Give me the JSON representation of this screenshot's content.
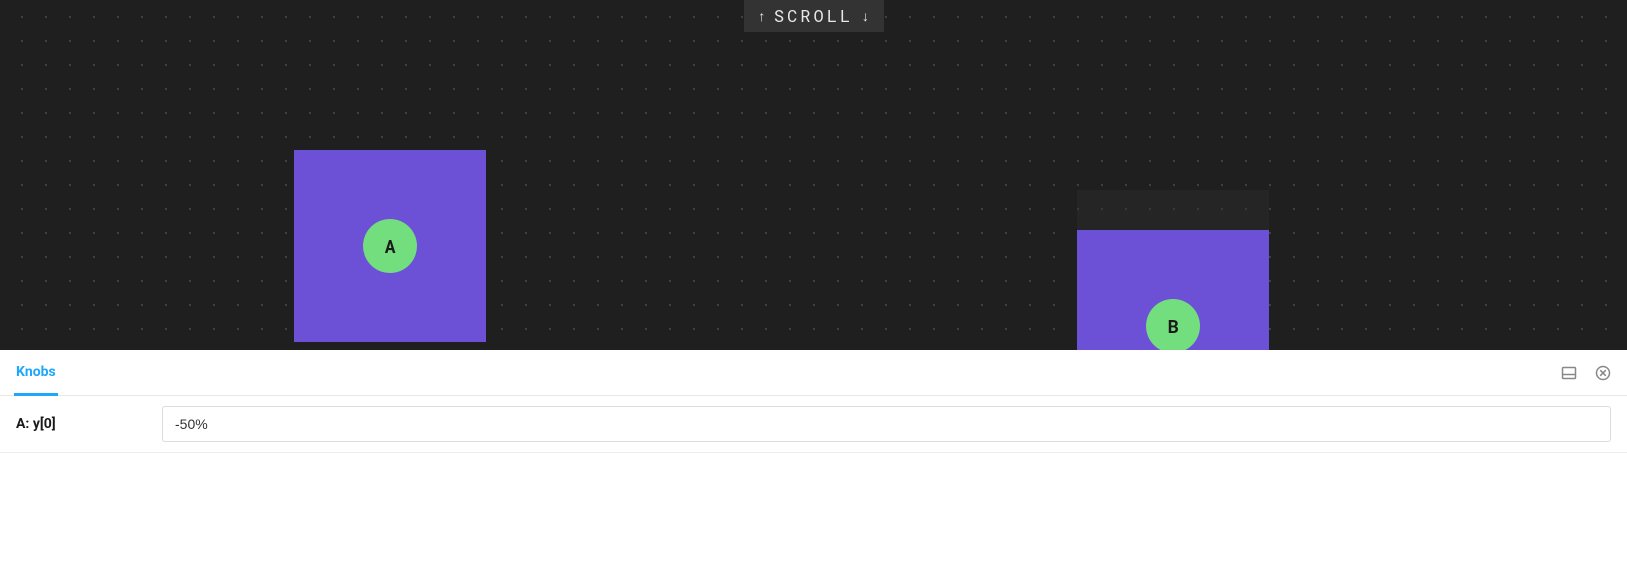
{
  "hint": {
    "text": "SCROLL"
  },
  "blocks": {
    "a": {
      "label": "A"
    },
    "b": {
      "label": "B"
    }
  },
  "panel": {
    "tab_label": "Knobs",
    "knob": {
      "label": "A: y[0]",
      "value": "-50%"
    }
  }
}
